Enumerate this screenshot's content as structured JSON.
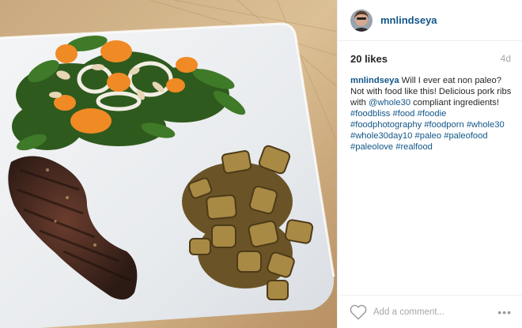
{
  "post": {
    "photo_alt": "photo",
    "username": "mnlindseya",
    "likes": "20 likes",
    "age": "4d",
    "caption": {
      "username": "mnlindseya",
      "text_1": " Will I ever eat non paleo? Not with food like this! Delicious pork ribs with ",
      "mention": "@whole30",
      "text_2": " compliant ingredients!",
      "tags_line_1": [
        "#foodbliss",
        "#food",
        "#foodie"
      ],
      "tags_line_2": [
        "#foodphotography",
        "#foodporn",
        "#whole30"
      ],
      "tags_line_3": [
        "#whole30day10",
        "#paleo",
        "#paleofood"
      ],
      "tags_line_4": [
        "#paleolove",
        "#realfood"
      ]
    },
    "comment_placeholder": "Add a comment...",
    "more_label": "•••"
  },
  "icons": {
    "heart": "heart-icon",
    "more": "more-options-icon"
  },
  "colors": {
    "link": "#125688",
    "muted": "#a5a7aa",
    "text": "#262626"
  }
}
